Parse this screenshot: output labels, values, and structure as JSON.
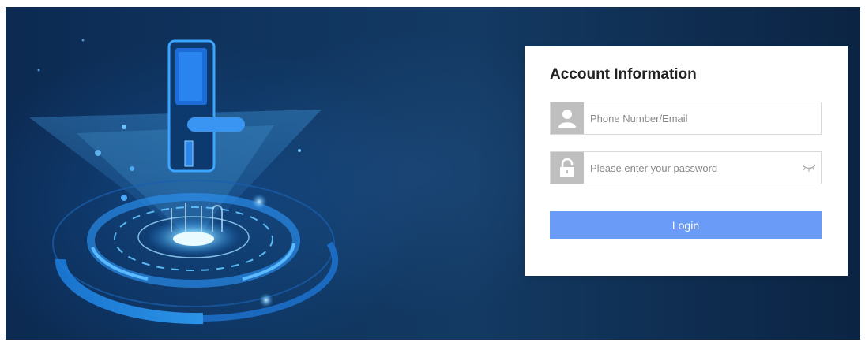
{
  "login_card": {
    "title": "Account Information",
    "username_placeholder": "Phone Number/Email",
    "password_placeholder": "Please enter your password",
    "login_label": "Login"
  },
  "colors": {
    "background_dark": "#0c2a52",
    "accent_glow": "#35a8ff",
    "login_button": "#6a9bf6",
    "icon_box": "#bfbfbf"
  },
  "icons": {
    "user": "user-icon",
    "lock": "lock-icon",
    "password_toggle": "eye-closed-icon"
  }
}
